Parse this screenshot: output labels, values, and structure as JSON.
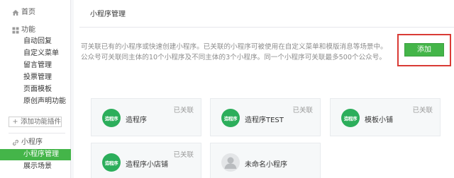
{
  "sidebar": {
    "home": "首页",
    "features_section": "功能",
    "features": [
      "自动回复",
      "自定义菜单",
      "留言管理",
      "投票管理",
      "页面模板",
      "原创声明功能"
    ],
    "add_plugin": "添加功能插件",
    "miniprogram_section": "小程序",
    "miniprogram_items": [
      "小程序管理",
      "展示场景"
    ],
    "active_item": "小程序管理"
  },
  "main": {
    "title": "小程序管理",
    "description": [
      "可关联已有的小程序或快速创建小程序。已关联的小程序可被使用在自定义菜单和模版消息等场景中。",
      "公众号可关联同主体的10个小程序及不同主体的3个小程序。同一个小程序可关联最多500个公众号。"
    ],
    "add_button": "添加",
    "cards": [
      {
        "name": "造程序",
        "status": "已关联",
        "logo_text": "造程序"
      },
      {
        "name": "造程序TEST",
        "status": "已关联",
        "logo_text": "造程序"
      },
      {
        "name": "模板小铺",
        "status": "已关联",
        "logo_text": "造程序"
      },
      {
        "name": "造程序小店铺",
        "status": "已关联",
        "logo_text": "造程序"
      },
      {
        "name": "未命名小程序",
        "status": "",
        "logo_text": ""
      }
    ]
  },
  "colors": {
    "accent_green": "#44b549",
    "highlight_red": "#d93b35",
    "logo_green": "#2cae5b"
  },
  "icons": {
    "home": "home-icon",
    "features": "grid-icon",
    "miniprogram": "link-icon",
    "default_avatar": "user-avatar-icon"
  }
}
